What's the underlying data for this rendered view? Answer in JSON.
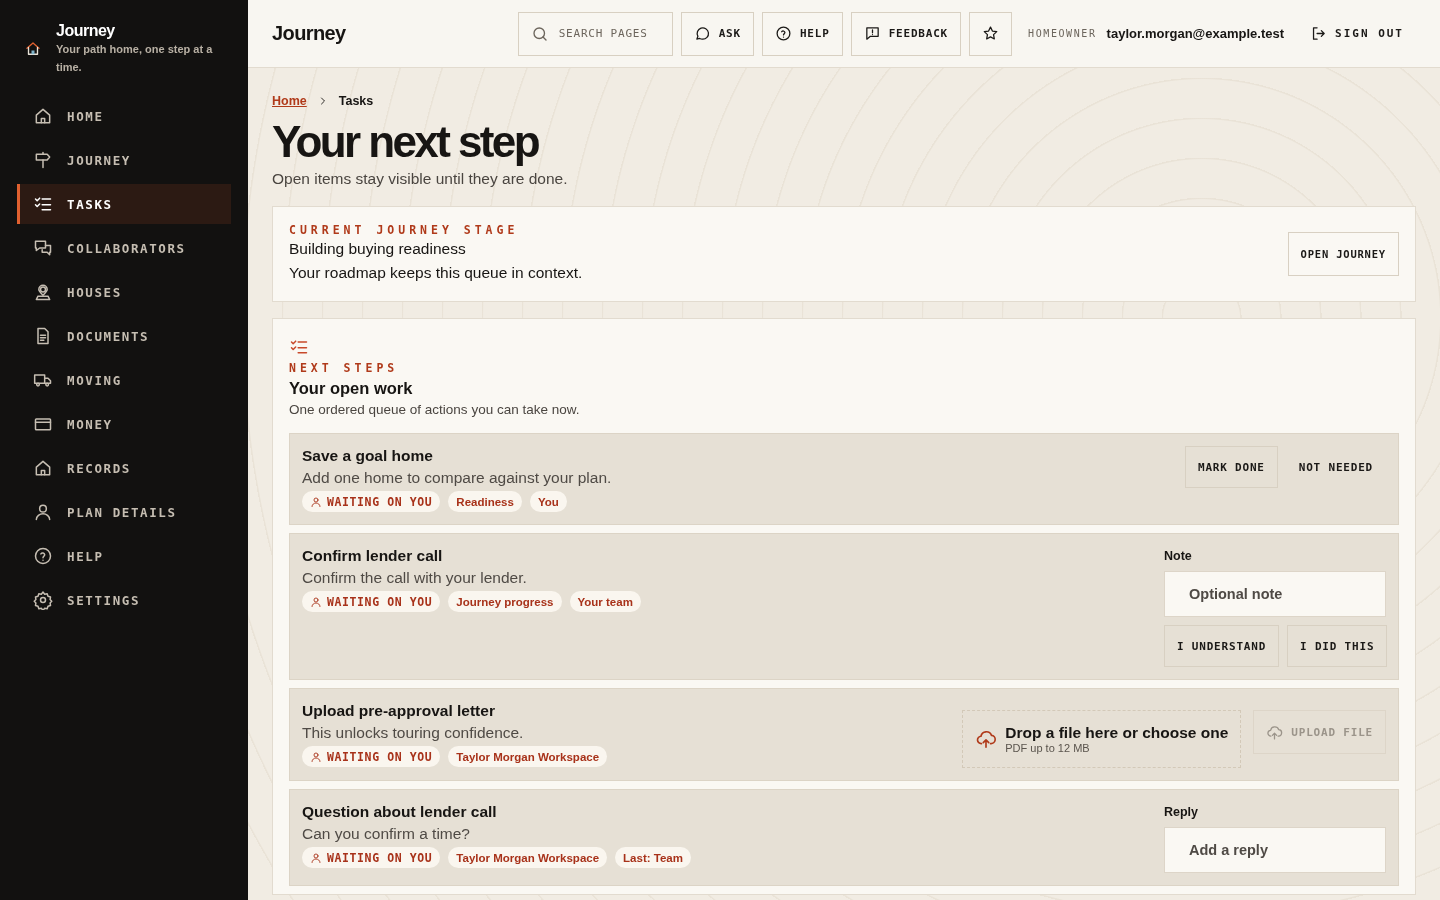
{
  "sidebar": {
    "brand": {
      "title": "Journey",
      "tagline": "Your path home, one step at a time."
    },
    "items": [
      {
        "label": "HOME",
        "selected": false
      },
      {
        "label": "JOURNEY",
        "selected": false
      },
      {
        "label": "TASKS",
        "selected": true
      },
      {
        "label": "COLLABORATORS",
        "selected": false
      },
      {
        "label": "HOUSES",
        "selected": false
      },
      {
        "label": "DOCUMENTS",
        "selected": false
      },
      {
        "label": "MOVING",
        "selected": false
      },
      {
        "label": "MONEY",
        "selected": false
      },
      {
        "label": "RECORDS",
        "selected": false
      },
      {
        "label": "PLAN DETAILS",
        "selected": false
      },
      {
        "label": "HELP",
        "selected": false
      },
      {
        "label": "SETTINGS",
        "selected": false
      }
    ]
  },
  "topbar": {
    "title": "Journey",
    "search": {
      "placeholder": "SEARCH PAGES"
    },
    "buttons": [
      "ASK",
      "HELP",
      "FEEDBACK"
    ],
    "role": "HOMEOWNER",
    "email": "taylor.morgan@example.test",
    "sign_out": "SIGN OUT"
  },
  "breadcrumb": [
    "Home",
    "Tasks"
  ],
  "heading": "Your next step",
  "subheading": "Open items stay visible until they are done.",
  "stage": {
    "eyebrow": "CURRENT JOURNEY STAGE",
    "name": "Building buying readiness",
    "note": "Your roadmap keeps this queue in context.",
    "button": "OPEN JOURNEY"
  },
  "queue": {
    "eyebrow": "NEXT STEPS",
    "title": "Your open work",
    "description": "One ordered queue of actions you can take now.",
    "tasks": [
      {
        "kind": "actions",
        "title": "Save a goal home",
        "description": "Add one home to compare against your plan.",
        "status": "WAITING ON YOU",
        "tags": [
          "Readiness",
          "You"
        ],
        "buttons": [
          "MARK DONE",
          "NOT NEEDED"
        ]
      },
      {
        "kind": "note",
        "title": "Confirm lender call",
        "description": "Confirm the call with your lender.",
        "status": "WAITING ON YOU",
        "tags": [
          "Journey progress",
          "Your team"
        ],
        "field_label": "Note",
        "placeholder": "Optional note",
        "buttons": [
          "I UNDERSTAND",
          "I DID THIS"
        ]
      },
      {
        "kind": "upload",
        "title": "Upload pre-approval letter",
        "description": "This unlocks touring confidence.",
        "status": "WAITING ON YOU",
        "tags": [
          "Taylor Morgan Workspace"
        ],
        "drop_title": "Drop a file here or choose one",
        "drop_hint": "PDF up to 12 MB",
        "button": "UPLOAD FILE",
        "disabled": true
      },
      {
        "kind": "reply",
        "title": "Question about lender call",
        "description": "Can you confirm a time?",
        "status": "WAITING ON YOU",
        "tags": [
          "Taylor Morgan Workspace",
          "Last: Team"
        ],
        "field_label": "Reply",
        "placeholder": "Add a reply"
      }
    ]
  }
}
